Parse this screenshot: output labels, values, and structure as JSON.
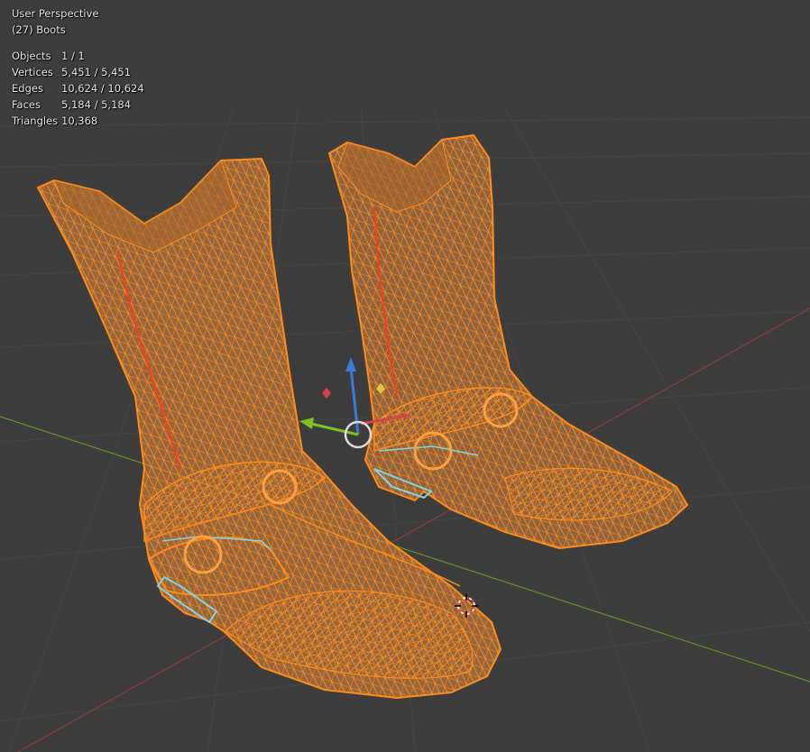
{
  "viewport": {
    "view_name": "User Perspective",
    "object_label": "(27) Boots"
  },
  "stats": [
    {
      "label": "Objects",
      "value": "1 / 1"
    },
    {
      "label": "Vertices",
      "value": "5,451 / 5,451"
    },
    {
      "label": "Edges",
      "value": "10,624 / 10,624"
    },
    {
      "label": "Faces",
      "value": "5,184 / 5,184"
    },
    {
      "label": "Triangles",
      "value": "10,368"
    }
  ],
  "colors": {
    "background": "#3d3d3d",
    "grid": "#454545",
    "x_axis": "#8b3a44",
    "y_axis": "#6c8f2a",
    "wire": "#ff8c1a",
    "fill": "#b7733a",
    "seam": "#ff3a1a",
    "sharp": "#7fd6e6",
    "gizmo_z": "#3a7bd9",
    "gizmo_y": "#7ec421",
    "gizmo_x": "#d9414a"
  },
  "icons": [
    "transform-gizmo-icon",
    "3d-cursor-icon"
  ]
}
